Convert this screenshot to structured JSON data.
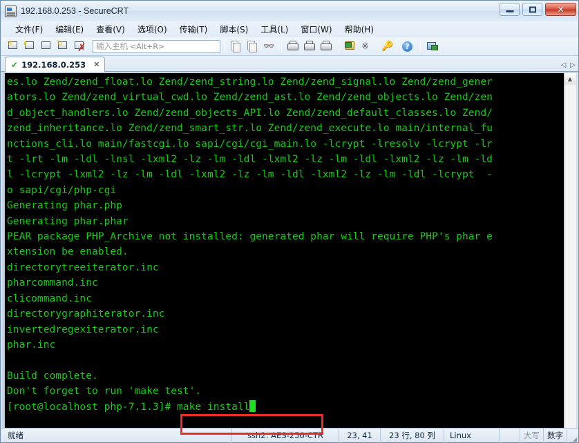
{
  "window": {
    "title": "192.168.0.253 - SecureCRT",
    "icon": "securecrt-app-icon",
    "minimize_label": "",
    "maximize_label": "",
    "close_label": "✕"
  },
  "menubar": {
    "items": [
      {
        "label": "文件(F)",
        "name": "menu-file"
      },
      {
        "label": "编辑(E)",
        "name": "menu-edit"
      },
      {
        "label": "查看(V)",
        "name": "menu-view"
      },
      {
        "label": "选项(O)",
        "name": "menu-options"
      },
      {
        "label": "传输(T)",
        "name": "menu-transfer"
      },
      {
        "label": "脚本(S)",
        "name": "menu-script"
      },
      {
        "label": "工具(L)",
        "name": "menu-tools"
      },
      {
        "label": "窗口(W)",
        "name": "menu-window"
      },
      {
        "label": "帮助(H)",
        "name": "menu-help"
      }
    ]
  },
  "toolbar": {
    "host_placeholder": "输入主机",
    "host_hint": "<Alt+R>",
    "host_value": "",
    "icons": [
      "new-session-icon",
      "clone-session-icon",
      "new-tab-icon",
      "reconnect-icon",
      "disconnect-icon",
      "copy-icon",
      "paste-icon",
      "find-icon",
      "print-screen-icon",
      "log-session-icon",
      "print-icon",
      "session-options-icon",
      "toggle-chat-icon",
      "key-icon",
      "help-icon",
      "session-manager-icon"
    ]
  },
  "tabs": {
    "items": [
      {
        "label": "192.168.0.253",
        "status_icon": "connected-check-icon",
        "close_icon": "✕"
      }
    ],
    "nav_prev": "◁",
    "nav_next": "▷"
  },
  "terminal": {
    "foreground": "#14cc14",
    "background": "#000000",
    "lines": [
      "es.lo Zend/zend_float.lo Zend/zend_string.lo Zend/zend_signal.lo Zend/zend_gener",
      "ators.lo Zend/zend_virtual_cwd.lo Zend/zend_ast.lo Zend/zend_objects.lo Zend/zen",
      "d_object_handlers.lo Zend/zend_objects_API.lo Zend/zend_default_classes.lo Zend/",
      "zend_inheritance.lo Zend/zend_smart_str.lo Zend/zend_execute.lo main/internal_fu",
      "nctions_cli.lo main/fastcgi.lo sapi/cgi/cgi_main.lo -lcrypt -lresolv -lcrypt -lr",
      "t -lrt -lm -ldl -lnsl -lxml2 -lz -lm -ldl -lxml2 -lz -lm -ldl -lxml2 -lz -lm -ld",
      "l -lcrypt -lxml2 -lz -lm -ldl -lxml2 -lz -lm -ldl -lxml2 -lz -lm -ldl -lcrypt  -",
      "o sapi/cgi/php-cgi",
      "Generating phar.php",
      "Generating phar.phar",
      "PEAR package PHP_Archive not installed: generated phar will require PHP's phar e",
      "xtension be enabled.",
      "directorytreeiterator.inc",
      "pharcommand.inc",
      "clicommand.inc",
      "directorygraphiterator.inc",
      "invertedregexiterator.inc",
      "phar.inc",
      "",
      "Build complete.",
      "Don't forget to run 'make test'.",
      ""
    ],
    "prompt": "[root@localhost php-7.1.3]# ",
    "command": "make install",
    "cursor": "block"
  },
  "annotation": {
    "highlight_color": "#ee2b20",
    "target": "make install command"
  },
  "statusbar": {
    "state": "就绪",
    "encryption": "ssh2: AES-256-CTR",
    "position": "23, 41",
    "dimensions": "23 行, 80 列",
    "os": "Linux",
    "caps": "大写",
    "num": "数字"
  }
}
